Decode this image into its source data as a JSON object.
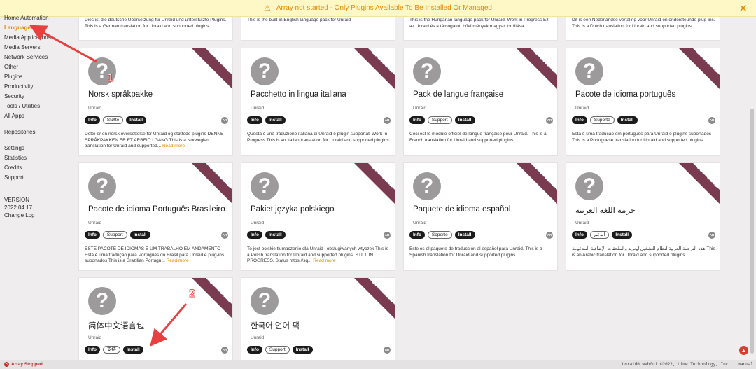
{
  "banner": {
    "text": "Array not started - Only Plugins Available To Be Installed Or Managed",
    "warn_icon": "warning-triangle-icon",
    "close_icon": "close-icon"
  },
  "sidebar": {
    "items": [
      {
        "label": "Home Automation",
        "active": false
      },
      {
        "label": "Language",
        "active": true
      },
      {
        "label": "Media Applications",
        "active": false
      },
      {
        "label": "Media Servers",
        "active": false
      },
      {
        "label": "Network Services",
        "active": false
      },
      {
        "label": "Other",
        "active": false
      },
      {
        "label": "Plugins",
        "active": false
      },
      {
        "label": "Productivity",
        "active": false
      },
      {
        "label": "Security",
        "active": false
      },
      {
        "label": "Tools / Utilities",
        "active": false
      },
      {
        "label": "All Apps",
        "active": false
      },
      {
        "label": "Repositories",
        "active": false
      },
      {
        "label": "Settings",
        "active": false
      },
      {
        "label": "Statistics",
        "active": false
      },
      {
        "label": "Credits",
        "active": false
      },
      {
        "label": "Support",
        "active": false
      }
    ],
    "version_label": "VERSION",
    "version_value": "2022.04.17",
    "changelog": "Change Log"
  },
  "ribbon_text": "OFFICIAL",
  "read_more": "Read more",
  "top_cards": [
    {
      "desc": "Dies ist die deutsche Übersetzung für Unraid und unterstützte Plugins. This is a German translation for Unraid and supported plugins"
    },
    {
      "desc": "This is the built-in English language pack for Unraid"
    },
    {
      "desc": "This is the Hungarian language pack for Unraid. Work in Progress Ez az Unraid és a támogatott bővítmények magyar fordítása."
    },
    {
      "desc": "Dit is een Nederlandse vertaling voor Unraid en ondersteunde plug-ins. This is a Dutch translation for Unraid and supported plugins."
    }
  ],
  "cards": [
    {
      "title": "Norsk språkpakke",
      "author": "Unraid",
      "buttons": [
        "Info",
        "Støtte",
        "Install"
      ],
      "desc": "Dette er en norsk oversettelse for Unraid og støttede plugins DENNE SPRÅKPAKKEN ER ET ARBEID I GANG This is a Norwegian translation for Unraid and supported...",
      "more": true
    },
    {
      "title": "Pacchetto in lingua italiana",
      "author": "Unraid",
      "buttons": [
        "Info",
        "Install"
      ],
      "desc": "Questa è una traduzione italiana di Unraid e plugin supportati Work in Progress This is an Italian translation for Unraid and supported plugins",
      "more": false
    },
    {
      "title": "Pack de langue française",
      "author": "Unraid",
      "buttons": [
        "Info",
        "Support",
        "Install"
      ],
      "desc": "Ceci est le module officiel de langue française pour Unraid. This is a French translation for Unraid and supported plugins.",
      "more": false
    },
    {
      "title": "Pacote de idioma português",
      "author": "Unraid",
      "buttons": [
        "Info",
        "Suporte",
        "Install"
      ],
      "desc": "Esta é uma tradução em português para Unraid e plugins suportados This is a Portuguese translation for Unraid and supported plugins",
      "more": false
    },
    {
      "title": "Pacote de idioma Português Brasileiro",
      "author": "Unraid",
      "buttons": [
        "Info",
        "Support",
        "Install"
      ],
      "desc": "ESTE PACOTE DE IDIOMAS É UM TRABALHO EM ANDAMENTO Esta é uma tradução para Português do Brasil para Unraid e plug-ins suportados This is a Brazilian Portugu...",
      "more": true
    },
    {
      "title": "Pakiet języka polskiego",
      "author": "Unraid",
      "buttons": [
        "Info",
        "Install"
      ],
      "desc": "To jest polskie tłumaczenie dla Unraid i obsługiwanych wtyczek This is a Polish translation for Unraid and supported plugins. STILL IN PROGRESS. Status  https://sq...",
      "more": true
    },
    {
      "title": "Paquete de idioma español",
      "author": "Unraid",
      "buttons": [
        "Info",
        "Soporte",
        "Install"
      ],
      "desc": "Este es el paquete de traducción al español para Unraid. This is a Spanish translation for Unraid and supported plugins.",
      "more": false
    },
    {
      "title": "حزمة اللغة العربية",
      "author": "Unraid",
      "buttons": [
        "Info",
        "الدعم",
        "Install"
      ],
      "desc": "هذه الترجمة العربية لنظام التشغيل أونريد والملحقات الإضافية المدعومة This is an Arabic translation for Unraid and supported plugins.",
      "more": false
    },
    {
      "title": "简体中文语言包",
      "author": "Unraid",
      "buttons": [
        "Info",
        "支持",
        "Install"
      ],
      "desc": "",
      "more": false
    },
    {
      "title": "한국어 언어 팩",
      "author": "Unraid",
      "buttons": [
        "Info",
        "Support",
        "Install"
      ],
      "desc": "",
      "more": false
    }
  ],
  "annotations": {
    "step1": "1",
    "step2": "2",
    "arrow_color": "#e84040"
  },
  "footer": {
    "status": "Array Stopped",
    "copyright": "Unraid® webGui ©2022, Lime Technology, Inc.",
    "manual": "manual"
  },
  "colors": {
    "accent": "#e68a00",
    "ribbon": "#7a3b50",
    "dark_button": "#1c1b1b"
  }
}
